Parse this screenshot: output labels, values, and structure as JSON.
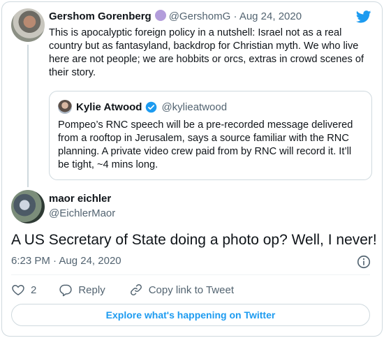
{
  "parent_tweet": {
    "author_name": "Gershom Gorenberg",
    "handle": "@GershomG",
    "separator": "·",
    "date": "Aug 24, 2020",
    "text": "This is apocalyptic foreign policy in a nutshell: Israel not as a real country but as fantasyland, backdrop for Christian myth. We who live here are not people; we are hobbits or orcs, extras in crowd scenes of their story."
  },
  "quoted_tweet": {
    "author_name": "Kylie Atwood",
    "handle": "@kylieatwood",
    "text": "Pompeo’s RNC speech will be a pre-recorded message delivered from a rooftop in Jerusalem, says a source familiar with the RNC planning. A private video crew paid from by RNC will record it.  It’ll be tight, ~4 mins long."
  },
  "main_tweet": {
    "author_name": "maor eichler",
    "handle": "@EichlerMaor",
    "text": "A US Secretary of State doing a photo op? Well, I never!",
    "time": "6:23 PM",
    "separator": "·",
    "date": "Aug 24, 2020"
  },
  "actions": {
    "like_count": "2",
    "reply_label": "Reply",
    "copy_link_label": "Copy link to Tweet"
  },
  "explore_label": "Explore what's happening on Twitter",
  "colors": {
    "accent": "#1d9bf0",
    "muted_text": "#536471",
    "border": "#cfd9de",
    "purple_badge": "#b39ddb"
  },
  "icons": [
    "twitter-bird-icon",
    "verified-badge-icon",
    "info-icon",
    "heart-icon",
    "reply-icon",
    "link-icon"
  ]
}
